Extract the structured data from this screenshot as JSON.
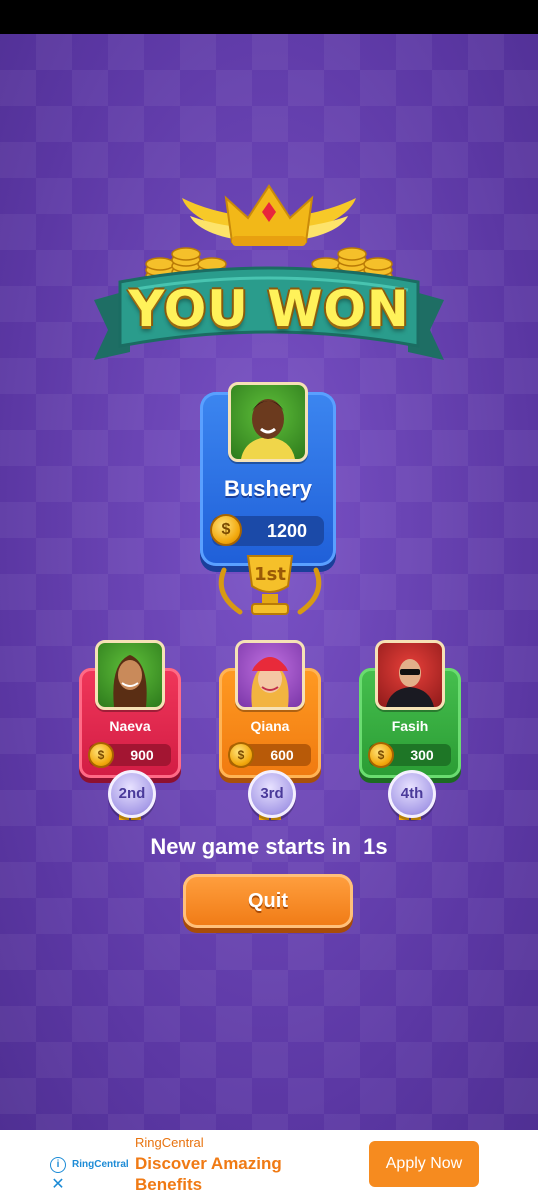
{
  "banner": {
    "title": "YOU WON"
  },
  "winner": {
    "name": "Bushery",
    "score": "1200",
    "rank": "1st"
  },
  "players": [
    {
      "name": "Naeva",
      "score": "900",
      "rank": "2nd",
      "color": "#e8284e"
    },
    {
      "name": "Qiana",
      "score": "600",
      "rank": "3rd",
      "color": "#f58a1b"
    },
    {
      "name": "Fasih",
      "score": "300",
      "rank": "4th",
      "color": "#38b042"
    }
  ],
  "coin_symbol": "$",
  "countdown": {
    "text": "New game starts in  1s"
  },
  "actions": {
    "quit_label": "Quit"
  },
  "ad": {
    "brand": "RingCentral",
    "logo_text": "RingCentral",
    "headline": "Discover Amazing Benefits",
    "cta_label": "Apply Now",
    "info_icon": "info-icon",
    "close_icon": "close-icon"
  },
  "colors": {
    "background": "#6a44b4",
    "gold": "#f2c21a",
    "winner_card": "#2a6fe4",
    "ad_accent": "#f68b1f"
  }
}
